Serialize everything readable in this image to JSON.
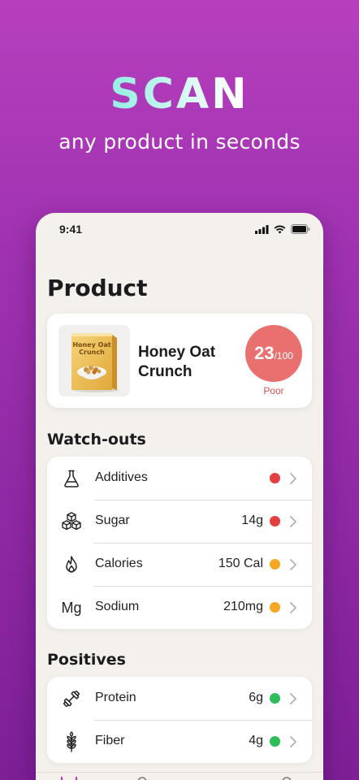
{
  "hero": {
    "title": "SCAN",
    "subtitle": "any product in seconds"
  },
  "status_bar": {
    "time": "9:41"
  },
  "page": {
    "title": "Product"
  },
  "product": {
    "name_line1": "Honey Oat",
    "name_line2": "Crunch",
    "box_text_line1": "Honey Oat",
    "box_text_line2": "Crunch",
    "score": "23",
    "score_max": "/100",
    "score_label": "Poor",
    "score_color": "#ea7070"
  },
  "watchouts": {
    "title": "Watch-outs",
    "items": [
      {
        "label": "Additives",
        "value": "",
        "icon": "flask-icon",
        "status": "red"
      },
      {
        "label": "Sugar",
        "value": "14g",
        "icon": "sugar-cubes-icon",
        "status": "red"
      },
      {
        "label": "Calories",
        "value": "150 Cal",
        "icon": "flame-icon",
        "status": "orange"
      },
      {
        "label": "Sodium",
        "value": "210mg",
        "icon_text": "Mg",
        "icon": "sodium-icon",
        "status": "orange"
      }
    ]
  },
  "positives": {
    "title": "Positives",
    "items": [
      {
        "label": "Protein",
        "value": "6g",
        "icon": "dumbbell-icon",
        "status": "green"
      },
      {
        "label": "Fiber",
        "value": "4g",
        "icon": "wheat-icon",
        "status": "green"
      }
    ]
  },
  "colors": {
    "red": "#e53e3e",
    "orange": "#f5a623",
    "green": "#2ebd59",
    "accent": "#b63fbd"
  }
}
